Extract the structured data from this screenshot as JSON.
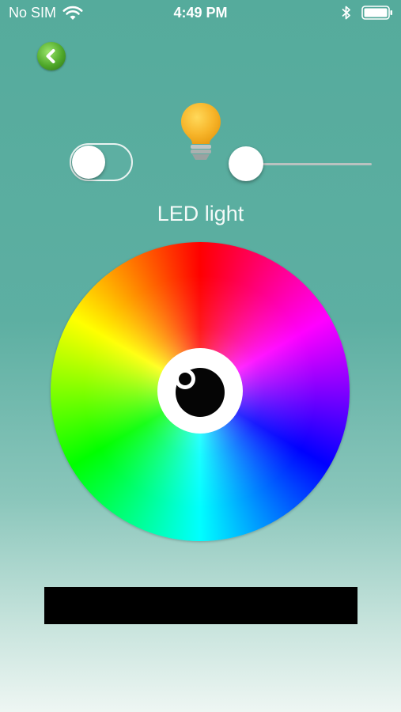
{
  "status_bar": {
    "carrier": "No SIM",
    "time": "4:49 PM",
    "wifi_icon": "wifi-icon",
    "bluetooth_icon": "bluetooth-icon",
    "battery_icon": "battery-icon"
  },
  "header": {
    "back_icon": "chevron-left-icon",
    "bulb_icon": "light-bulb-icon",
    "title": "LED light"
  },
  "controls": {
    "power_on": false,
    "brightness_fraction": 0.0
  },
  "color_wheel": {
    "selected_color": "#000000"
  },
  "colors": {
    "background_top": "#55ab9c",
    "background_bottom": "#eef6f3",
    "back_button": "#4fa82a",
    "bulb": "#f7b52a"
  }
}
